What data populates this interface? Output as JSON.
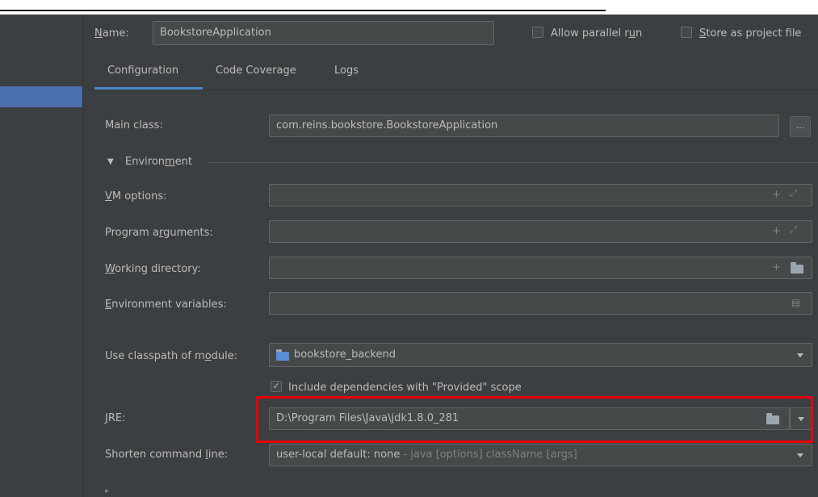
{
  "header": {
    "name_label_prefix": "",
    "name_label_u": "N",
    "name_label_rest": "ame:",
    "name_value": "BookstoreApplication",
    "allow_parallel_pre": "Allow parallel r",
    "allow_parallel_u": "u",
    "allow_parallel_post": "n",
    "store_u": "S",
    "store_rest": "tore as project file"
  },
  "tabs": [
    {
      "label": "Configuration",
      "active": true
    },
    {
      "label": "Code Coverage",
      "active": false
    },
    {
      "label": "Logs",
      "active": false
    }
  ],
  "form": {
    "main_class_label": "Main class:",
    "main_class_value": "com.reins.bookstore.BookstoreApplication",
    "browse_label": "...",
    "env_section_pre": "Environ",
    "env_section_u": "m",
    "env_section_post": "ent",
    "vm_options_u": "V",
    "vm_options_rest": "M options:",
    "program_args_pre": "Program a",
    "program_args_u": "r",
    "program_args_post": "guments:",
    "working_dir_u": "W",
    "working_dir_rest": "orking directory:",
    "env_vars_u": "E",
    "env_vars_rest": "nvironment variables:",
    "classpath_pre": "Use classpath of m",
    "classpath_u": "o",
    "classpath_post": "dule:",
    "classpath_value": "bookstore_backend",
    "include_deps_label": "Include dependencies with \"Provided\" scope",
    "jre_u": "J",
    "jre_rest": "RE:",
    "jre_value": "D:\\Program Files\\Java\\jdk1.8.0_281",
    "shorten_pre": "Shorten command ",
    "shorten_u": "l",
    "shorten_post": "ine:",
    "shorten_value": "user-local default: none",
    "shorten_hint": " - java [options] className [args]"
  },
  "colors": {
    "background": "#3c3f41",
    "field": "#45494a",
    "selection": "#4b6eaf",
    "tab_accent": "#4a88c7",
    "highlight": "#e8000b"
  }
}
